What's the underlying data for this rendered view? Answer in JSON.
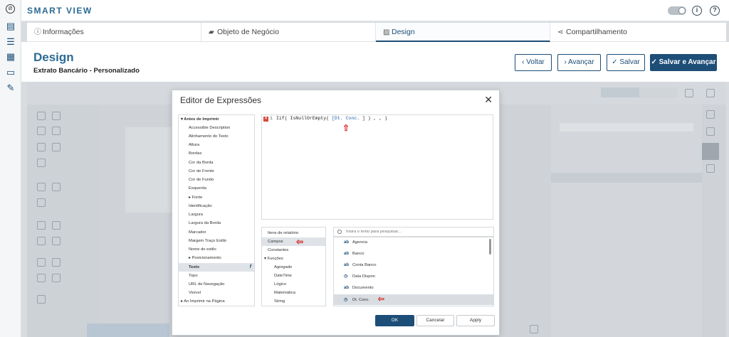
{
  "app": {
    "brand": "SMART VIEW"
  },
  "tabs": [
    {
      "label": "Informações",
      "icon": "info-icon"
    },
    {
      "label": "Objeto de Negócio",
      "icon": "briefcase-icon"
    },
    {
      "label": "Design",
      "icon": "image-icon"
    },
    {
      "label": "Compartilhamento",
      "icon": "share-icon"
    }
  ],
  "page": {
    "title": "Design",
    "subtitle": "Extrato Bancário - Personalizado"
  },
  "actions": {
    "back": "‹ Voltar",
    "next": "› Avançar",
    "save": "✓ Salvar",
    "save_next": "✓ Salvar e Avançar"
  },
  "modal": {
    "title": "Editor de Expressões",
    "code_line_number": "1",
    "code_prefix": "Iif( IsNullOrEmpty( ",
    "code_field": "[Dt. Conc.",
    "code_suffix": " ] ) , , )",
    "properties": [
      "▾ Antes de Imprimir",
      "Accessible Description",
      "Alinhamento do Texto",
      "Altura",
      "Bordas",
      "Cor da Borda",
      "Cor de Frente",
      "Cor de Fundo",
      "Esquerda",
      "▸ Fonte",
      "Identificação",
      "Largura",
      "Largura da Borda",
      "Marcador",
      "Margem Traço Estilo",
      "Nome do estilo",
      "▸ Posicionamento",
      "Texto",
      "Topo",
      "URL de Navegação",
      "Visível",
      "▸ Ao Imprimir na Página"
    ],
    "categories": [
      "Itens de relatório",
      "Campos",
      "Constantes",
      "▾ Funções",
      "Agregado",
      "DateTime",
      "Lógico",
      "Matemática",
      "String"
    ],
    "search_placeholder": "Insira o texto para pesquisar...",
    "fields": [
      {
        "type": "ab",
        "label": "Agencia"
      },
      {
        "type": "ab",
        "label": "Banco"
      },
      {
        "type": "ab",
        "label": "Conta Banco"
      },
      {
        "type": "clock",
        "label": "Data Dispon"
      },
      {
        "type": "ab",
        "label": "Documento"
      },
      {
        "type": "clock",
        "label": "Dt. Conc."
      }
    ],
    "buttons": {
      "ok": "OK",
      "cancel": "Cancelar",
      "apply": "Apply"
    }
  },
  "colors": {
    "brand": "#2c6b94",
    "primary": "#1d4e78",
    "annotation": "#d52b2b"
  }
}
